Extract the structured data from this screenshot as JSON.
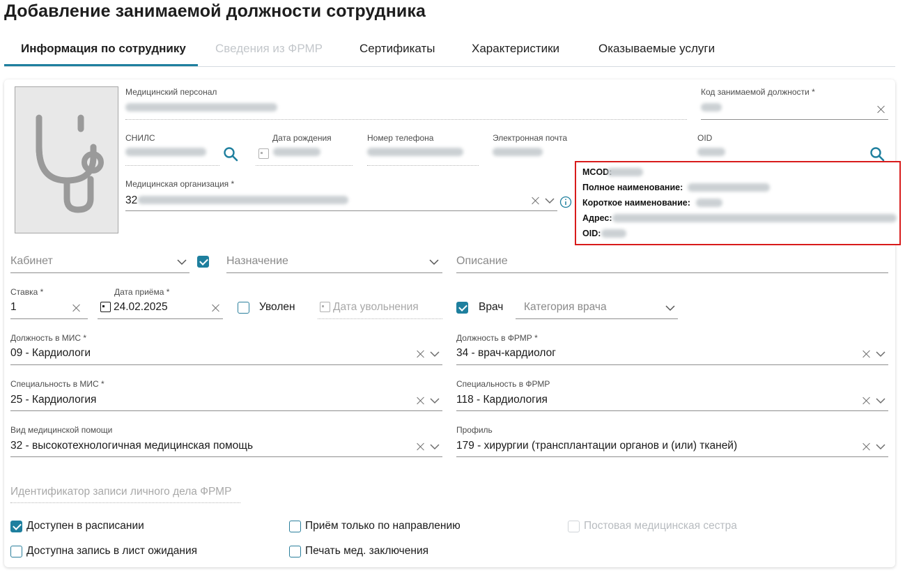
{
  "page": {
    "title": "Добавление занимаемой должности сотрудника"
  },
  "tabs": [
    {
      "label": "Информация по сотруднику",
      "state": "active"
    },
    {
      "label": "Сведения из ФРМР",
      "state": "disabled"
    },
    {
      "label": "Сертификаты",
      "state": "normal"
    },
    {
      "label": "Характеристики",
      "state": "normal"
    },
    {
      "label": "Оказываемые услуги",
      "state": "normal"
    }
  ],
  "employee": {
    "photo_icon": "stethoscope-icon",
    "personnel_label": "Медицинский персонал",
    "position_code_label": "Код занимаемой должности *",
    "snils_label": "СНИЛС",
    "birthdate_label": "Дата рождения",
    "phone_label": "Номер телефона",
    "email_label": "Электронная почта",
    "oid_label": "OID",
    "org_label": "Медицинская организация *",
    "org_value_prefix": "32"
  },
  "org_tooltip": {
    "mcod_label": "МCOD:",
    "full_name_label": "Полное наименование:",
    "short_name_label": "Короткое наименование:",
    "address_label": "Адрес:",
    "oid_label": "OID:",
    "border_color": "#d81b1b"
  },
  "form": {
    "cabinet_placeholder": "Кабинет",
    "assignment_placeholder": "Назначение",
    "assignment_checked": true,
    "description_placeholder": "Описание",
    "rate_label": "Ставка *",
    "rate_value": "1",
    "hire_date_label": "Дата приёма *",
    "hire_date_value": "24.02.2025",
    "dismissed_label": "Уволен",
    "dismissed_checked": false,
    "dismissal_date_placeholder": "Дата увольнения",
    "doctor_label": "Врач",
    "doctor_checked": true,
    "doctor_category_placeholder": "Категория врача",
    "mis_position_label": "Должность в МИС *",
    "mis_position_value": "09 - Кардиологи",
    "frmr_position_label": "Должность в ФРМР *",
    "frmr_position_value": "34 - врач-кардиолог",
    "mis_specialty_label": "Специальность в МИС *",
    "mis_specialty_value": "25 - Кардиология",
    "frmr_specialty_label": "Специальность в ФРМР",
    "frmr_specialty_value": "118 - Кардиология",
    "care_type_label": "Вид медицинской помощи",
    "care_type_value": "32 - высокотехнологичная медицинская помощь",
    "profile_label": "Профиль",
    "profile_value": "179 - хирургии (трансплантации органов и (или) тканей)",
    "frmr_record_id_placeholder": "Идентификатор записи личного дела ФРМР"
  },
  "checkboxes": {
    "schedule_available": {
      "label": "Доступен в расписании",
      "checked": true
    },
    "referral_only": {
      "label": "Приём только по направлению",
      "checked": false
    },
    "ward_nurse": {
      "label": "Постовая медицинская сестра",
      "checked": false,
      "disabled": true
    },
    "waitlist_available": {
      "label": "Доступна запись в лист ожидания",
      "checked": false
    },
    "print_conclusion": {
      "label": "Печать мед. заключения",
      "checked": false
    }
  },
  "colors": {
    "accent": "#1e7f9e",
    "highlight_border": "#d81b1b"
  }
}
